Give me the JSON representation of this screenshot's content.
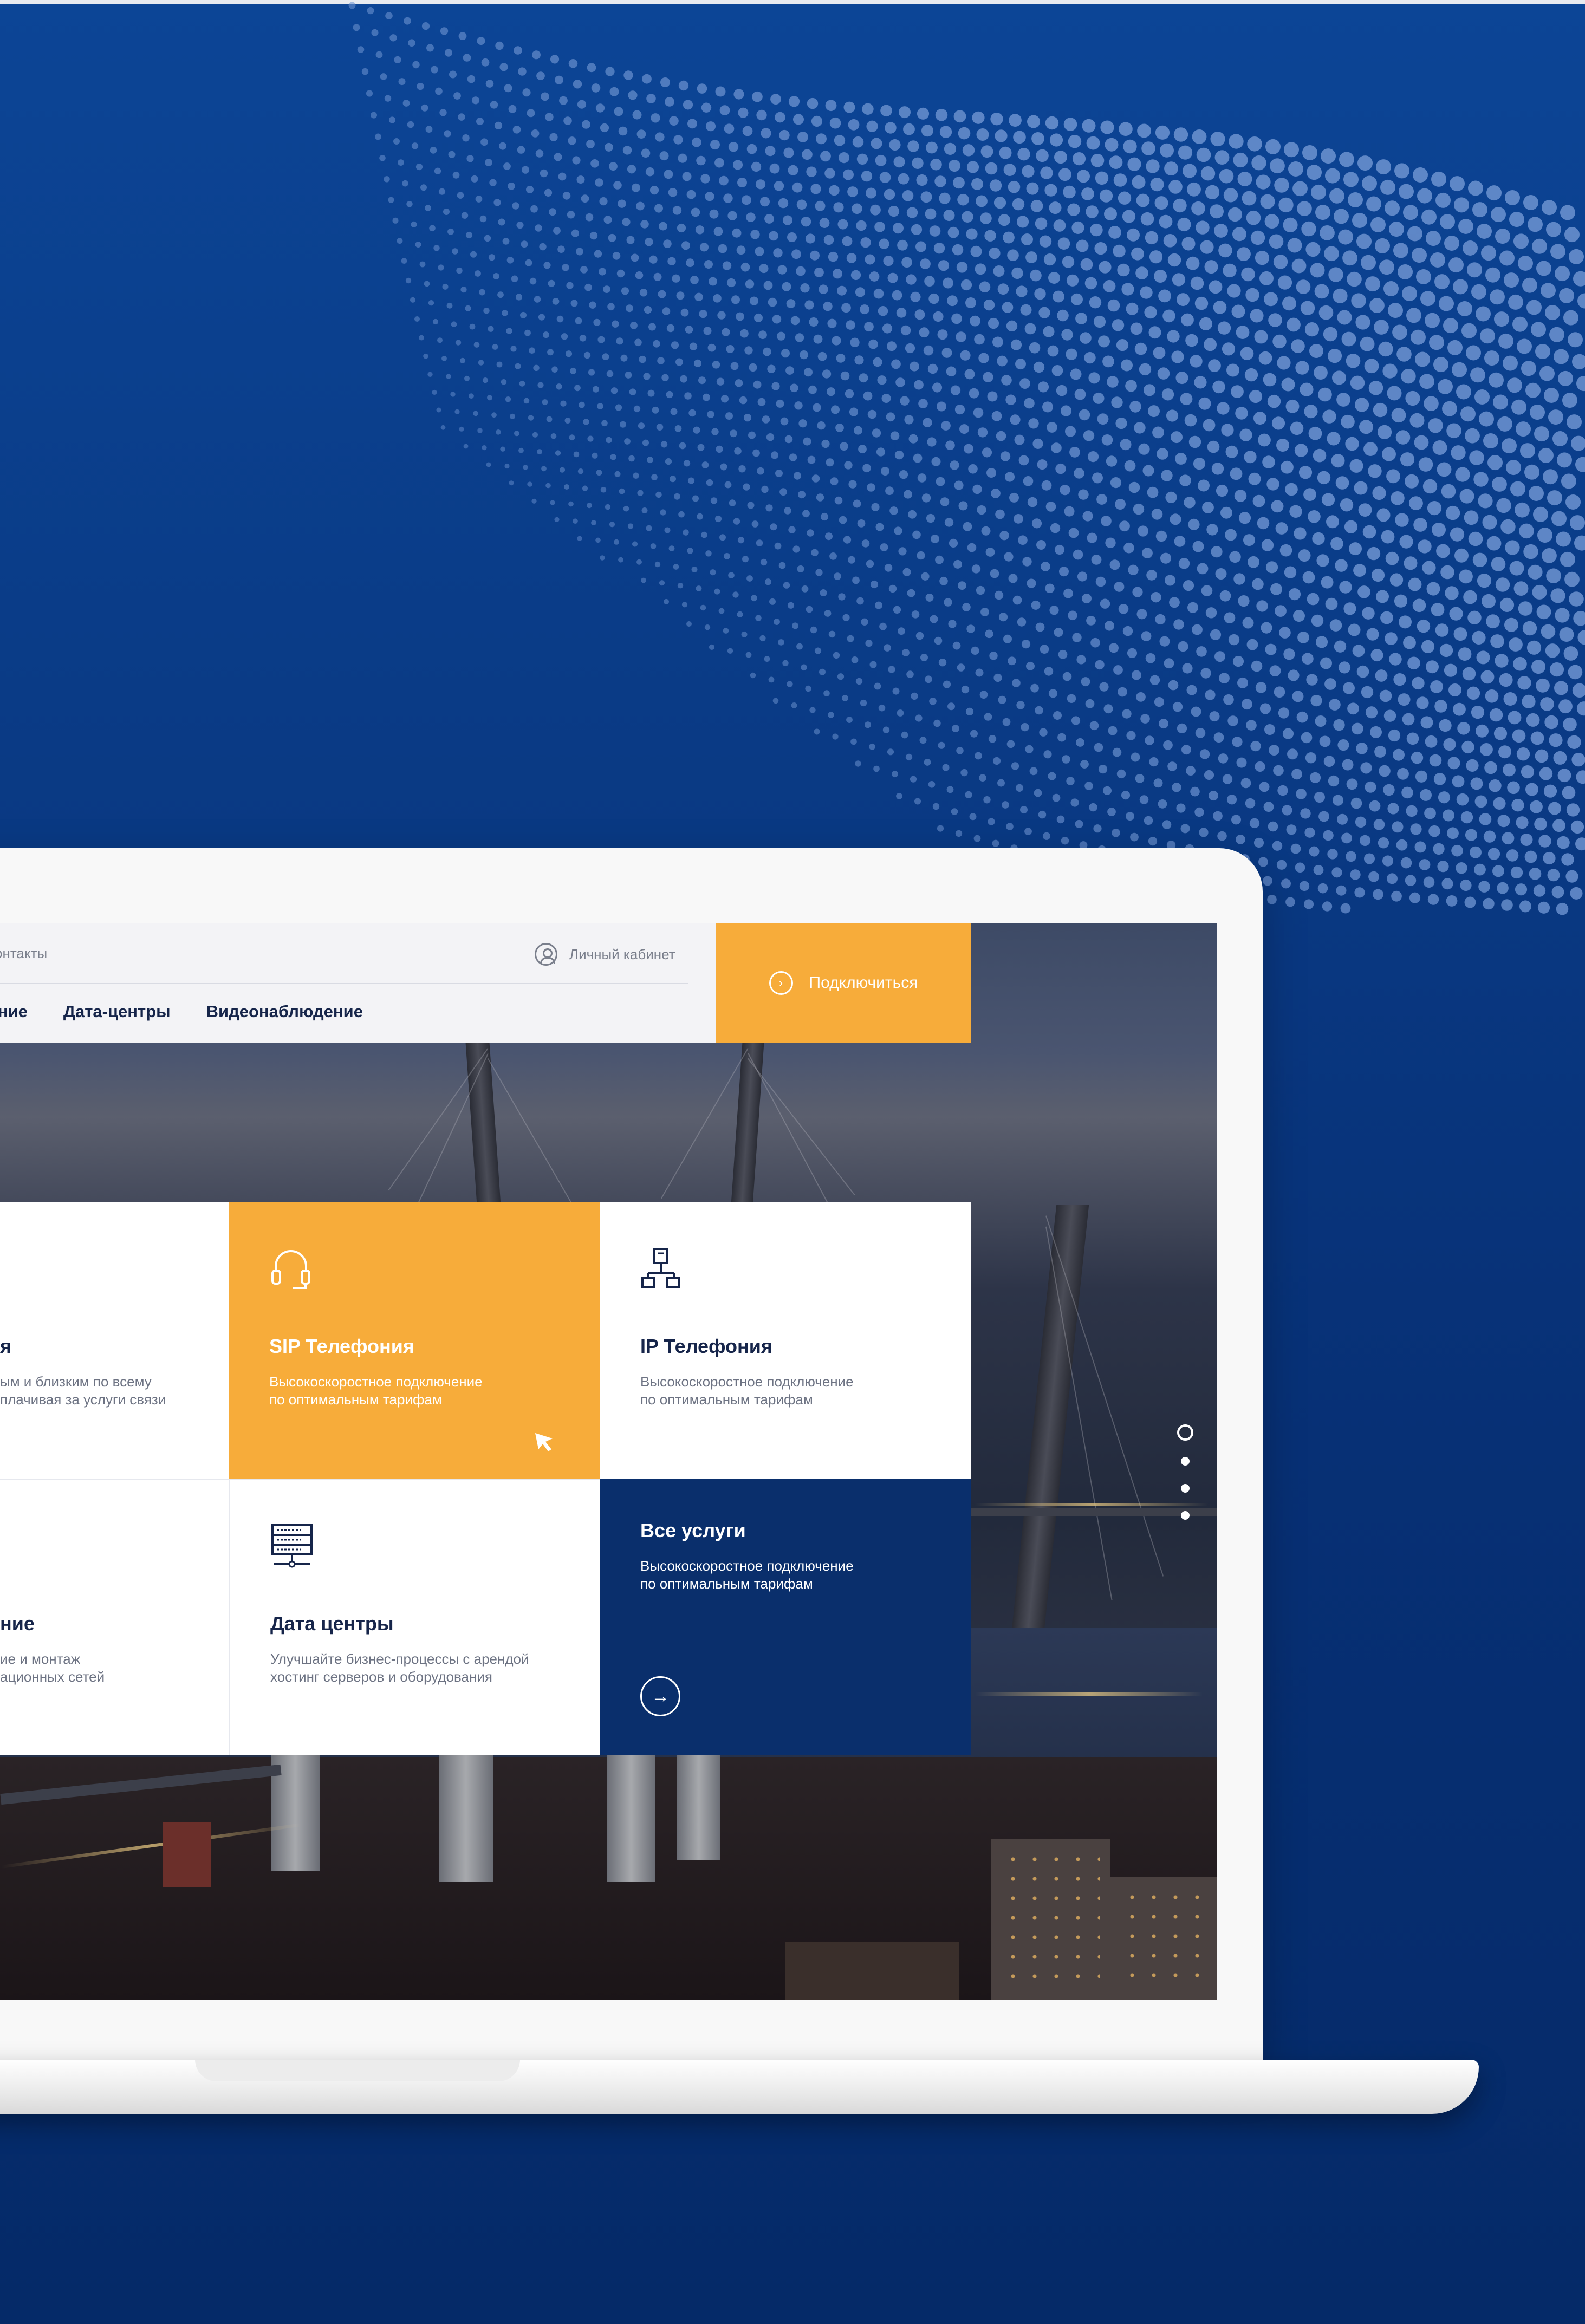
{
  "header": {
    "contacts_link": "онтакты",
    "account_link": "Личный кабинет",
    "connect_button": "Подключиться",
    "nav": [
      "вание",
      "Дата-центры",
      "Видеонаблюдение"
    ]
  },
  "tiles": {
    "left_top": {
      "title": "я",
      "desc_line1": "ым и близким по всему",
      "desc_line2": "плачивая за услуги связи"
    },
    "sip": {
      "title": "SIP Телефония",
      "desc_line1": "Высокоскоростное подключение",
      "desc_line2": "по оптимальным тарифам"
    },
    "ip": {
      "title": "IP Телефония",
      "desc_line1": "Высокоскоростное подключение",
      "desc_line2": "по оптимальным тарифам"
    },
    "left_bottom": {
      "title": "ние",
      "desc_line1": "ие и монтаж",
      "desc_line2": "ационных сетей"
    },
    "datacenter": {
      "title": "Дата центры",
      "desc_line1": "Улучшайте бизнес-процессы с арендой",
      "desc_line2": "хостинг серверов и оборудования"
    },
    "all_services": {
      "title": "Все услуги",
      "desc_line1": "Высокоскоростное подключение",
      "desc_line2": "по оптимальным тарифам"
    }
  },
  "slider": {
    "count": 4,
    "active_index": 0
  },
  "icons": {
    "account": "user-circle-icon",
    "connect": "play-circle-icon",
    "sip": "headset-icon",
    "ip": "network-icon",
    "datacenter": "server-icon",
    "all_services_arrow": "arrow-right-icon",
    "cursor": "cursor-icon"
  },
  "colors": {
    "background": "#0a3b86",
    "accent_orange": "#f7ac3a",
    "navy": "#0a2f6c",
    "header_bg": "#f3f3f6",
    "text_dark": "#16254a",
    "text_muted": "#6d7383"
  }
}
